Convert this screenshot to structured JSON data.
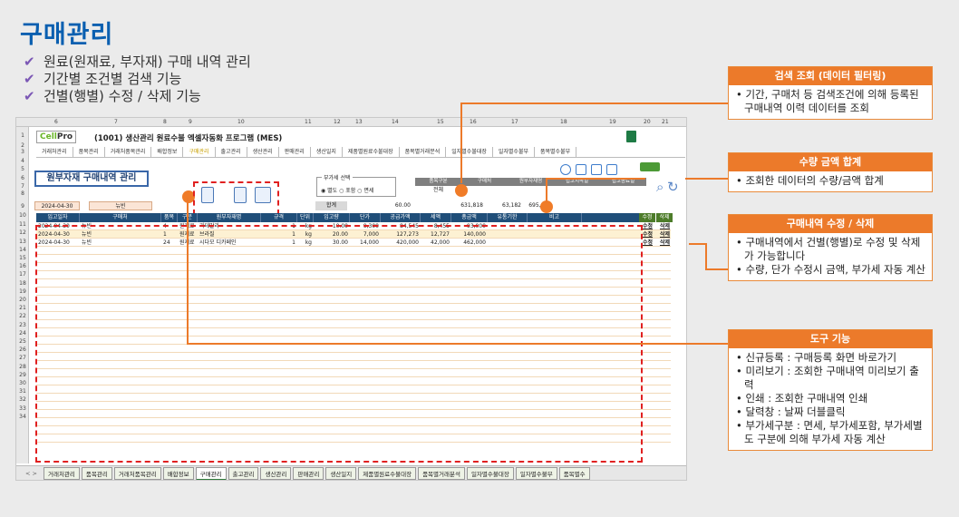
{
  "title": "구매관리",
  "bullets": [
    "원료(원재료, 부자재) 구매 내역 관리",
    "기간별 조건별 검색 기능",
    "건별(행별) 수정 / 삭제 기능"
  ],
  "sheet": {
    "col_headers": [
      "6",
      "7",
      "8",
      "9",
      "10",
      "11",
      "12",
      "13",
      "14",
      "15",
      "16",
      "17",
      "18",
      "19",
      "20",
      "21"
    ],
    "row_headers": [
      "1",
      "2",
      "3",
      "4",
      "5",
      "6",
      "7",
      "8",
      "9",
      "10",
      "11",
      "12",
      "13",
      "14",
      "15",
      "16",
      "17",
      "18",
      "19",
      "20",
      "21",
      "22",
      "23",
      "24",
      "25",
      "26",
      "27",
      "28",
      "29",
      "30",
      "31",
      "32",
      "33",
      "34"
    ],
    "logo_a": "Cell",
    "logo_b": "Pro",
    "app_title": "(1001) 생산관리 원료수불 엑셀자동화 프로그램 (MES)",
    "menu": [
      "거래처관리",
      "품목관리",
      "거래처품목관리",
      "배합정보",
      "구매관리",
      "출고관리",
      "생산관리",
      "판매관리",
      "생산일지",
      "제품별원료수불대장",
      "품목별거래분석",
      "일자별수불대장",
      "일자별수불부",
      "품목별수불부"
    ],
    "form_title": "원부자재 구매내역 관리",
    "vat_label": "부가세 선택",
    "vat_options": "◉ 별도 ○ 포함 ○ 면세",
    "search_headers": [
      "품목구분",
      "구매처",
      "원부자재명",
      "입고시작일",
      "입고종료일"
    ],
    "search_value": "전체",
    "date": "2024-04-30",
    "new_label": "뉴빈",
    "sum_label": "합계",
    "sum_values": [
      "60.00",
      "631,818",
      "63,182",
      "695,000"
    ],
    "grid_headers": [
      "입고일자",
      "구매처",
      "품목ID",
      "구분",
      "원부자재명",
      "규격",
      "단위",
      "입고량",
      "단가",
      "공급가액",
      "세액",
      "총금액",
      "유통기한",
      "비고"
    ],
    "rows": [
      [
        "2024-04-30",
        "뉴빈",
        "4",
        "원재료",
        "과테말라",
        "1",
        "kg",
        "10.00",
        "9,300",
        "84,545",
        "8,455",
        "93,000",
        "",
        ""
      ],
      [
        "2024-04-30",
        "뉴빈",
        "1",
        "원재료",
        "브라질",
        "1",
        "kg",
        "20.00",
        "7,000",
        "127,273",
        "12,727",
        "140,000",
        "",
        ""
      ],
      [
        "2024-04-30",
        "뉴빈",
        "24",
        "원재료",
        "시다모 디카페인",
        "1",
        "kg",
        "30.00",
        "14,000",
        "420,000",
        "42,000",
        "462,000",
        "",
        ""
      ]
    ],
    "action_headers": [
      "수정",
      "삭제"
    ],
    "action_labels": [
      "수정",
      "삭제"
    ],
    "tabs": [
      "거래처관리",
      "품목관리",
      "거래처품목관리",
      "배합정보",
      "구매관리",
      "출고관리",
      "생산관리",
      "판매관리",
      "생산일지",
      "제품별원료수불대장",
      "품목별거래분석",
      "일자별수불대장",
      "일자별수불부",
      "품목별수"
    ],
    "tab_nav": "<  >"
  },
  "panels": [
    {
      "title": "검색 조회 (데이터 필터링)",
      "items": [
        "기간, 구매처 등 검색조건에 의해 등록된 구매내역 이력 데이터를 조회"
      ]
    },
    {
      "title": "수량 금액 합계",
      "items": [
        "조회한 데이터의 수량/금액 합계"
      ]
    },
    {
      "title": "구매내역 수정 / 삭제",
      "items": [
        "구매내역에서 건별(행별)로 수정 및 삭제가 가능합니다",
        "수량, 단가 수정시 금액, 부가세 자동 계산"
      ]
    },
    {
      "title": "도구 기능",
      "items": [
        "신규등록 : 구매등록 화면 바로가기",
        "미리보기 : 조회한 구매내역 미리보기 출력",
        "인쇄 : 조회한 구매내역 인쇄",
        "달력창 : 날짜 더블클릭",
        "부가세구분 : 면세, 부가세포함, 부가세별도 구분에 의해 부가세 자동 계산"
      ]
    }
  ],
  "colors": {
    "accent": "#ec7a2a",
    "title": "#0a5fb0",
    "header": "#1f4e79",
    "highlight": "#e02020"
  }
}
